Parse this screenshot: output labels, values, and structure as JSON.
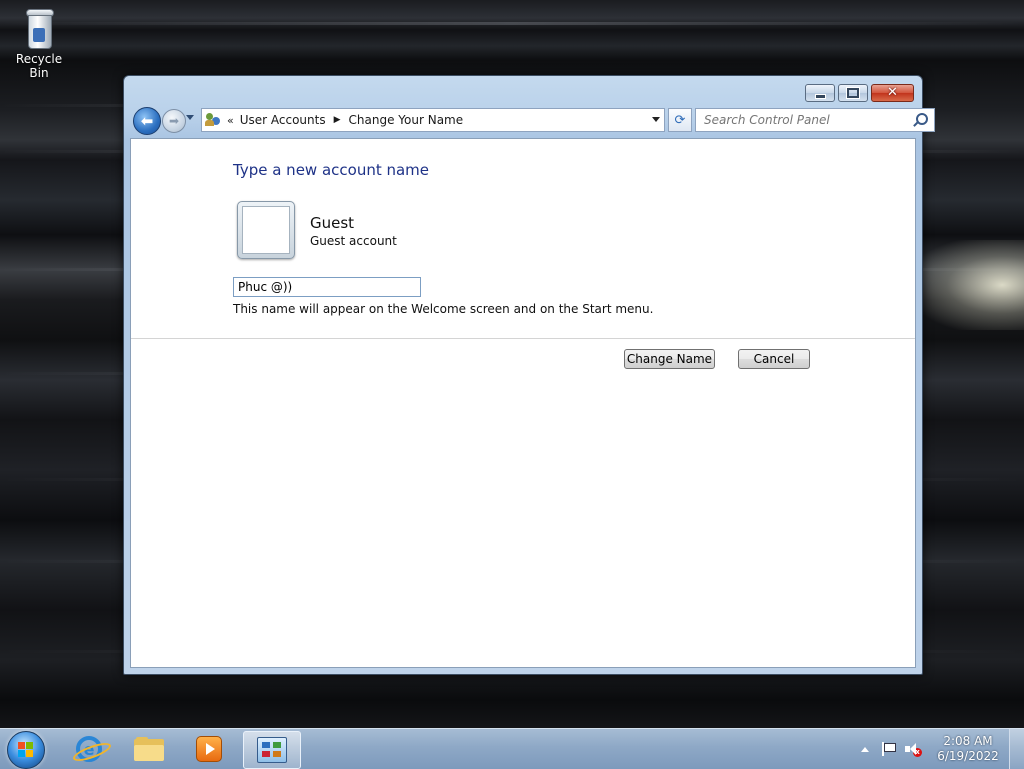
{
  "desktop": {
    "recycle_bin_label": "Recycle Bin"
  },
  "window": {
    "nav": {
      "breadcrumb_overflow": "«",
      "breadcrumb": [
        "User Accounts",
        "Change Your Name"
      ],
      "search_placeholder": "Search Control Panel"
    },
    "content": {
      "heading": "Type a new account name",
      "account_name": "Guest",
      "account_type": "Guest account",
      "name_input_value": "Phuc @))",
      "hint": "This name will appear on the Welcome screen and on the Start menu.",
      "change_name_button": "Change Name",
      "cancel_button": "Cancel"
    }
  },
  "taskbar": {
    "pinned": [
      "internet-explorer",
      "windows-explorer",
      "media-player",
      "control-panel"
    ],
    "active_app": "control-panel",
    "clock_time": "2:08 AM",
    "clock_date": "6/19/2022"
  },
  "colors": {
    "heading": "#1e3287",
    "window_frame": "#b9d1ea",
    "taskbar": "#8ea8c6"
  }
}
